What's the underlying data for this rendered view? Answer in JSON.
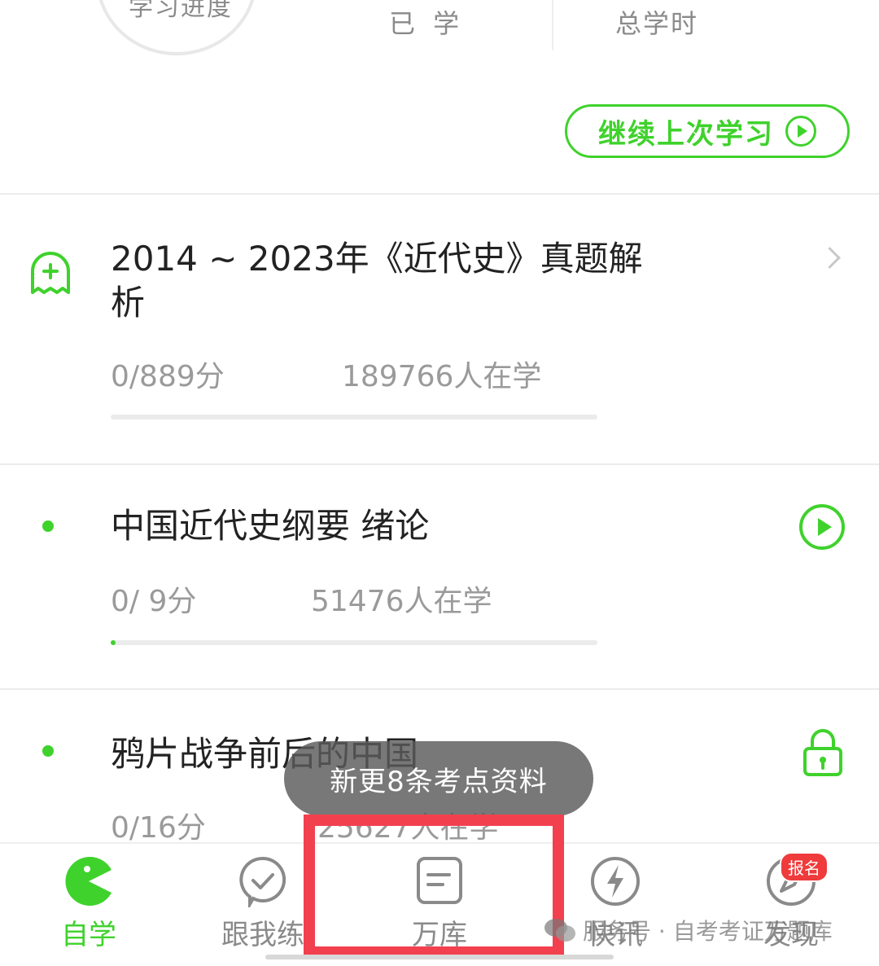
{
  "header": {
    "progress_label": "学习进度",
    "learned_label": "已 学",
    "total_hours_label": "总学时",
    "continue_button": "继续上次学习"
  },
  "courses": [
    {
      "title": "2014 ~ 2023年《近代史》真题解析",
      "title_line1": "2014 ~ 2023年《近代史》真题解",
      "title_line2": "析",
      "score": "0/889分",
      "learners": "189766人在学",
      "progress": 0,
      "action_icon": "chevron-right-icon"
    },
    {
      "title": "中国近代史纲要 绪论",
      "score": "0/ 9分",
      "learners": "51476人在学",
      "progress": 0.01,
      "action_icon": "play-icon"
    },
    {
      "title": "鸦片战争前后的中国",
      "score": "0/16分",
      "learners": "25627人在学",
      "action_icon": "lock-icon"
    }
  ],
  "toast": "新更8条考点资料",
  "nav": {
    "items": [
      {
        "label": "自学",
        "icon": "pacman-icon",
        "active": true
      },
      {
        "label": "跟我练",
        "icon": "check-badge-icon",
        "active": false
      },
      {
        "label": "万库",
        "icon": "document-icon",
        "active": false
      },
      {
        "label": "快讯",
        "icon": "lightning-icon",
        "active": false
      },
      {
        "label": "发现",
        "icon": "compass-icon",
        "active": false,
        "badge": "报名"
      }
    ]
  },
  "watermark": "服务号 · 自考考证万题库",
  "colors": {
    "accent": "#3fd22c",
    "highlight": "#f2404f",
    "badge": "#ef3b3b"
  }
}
